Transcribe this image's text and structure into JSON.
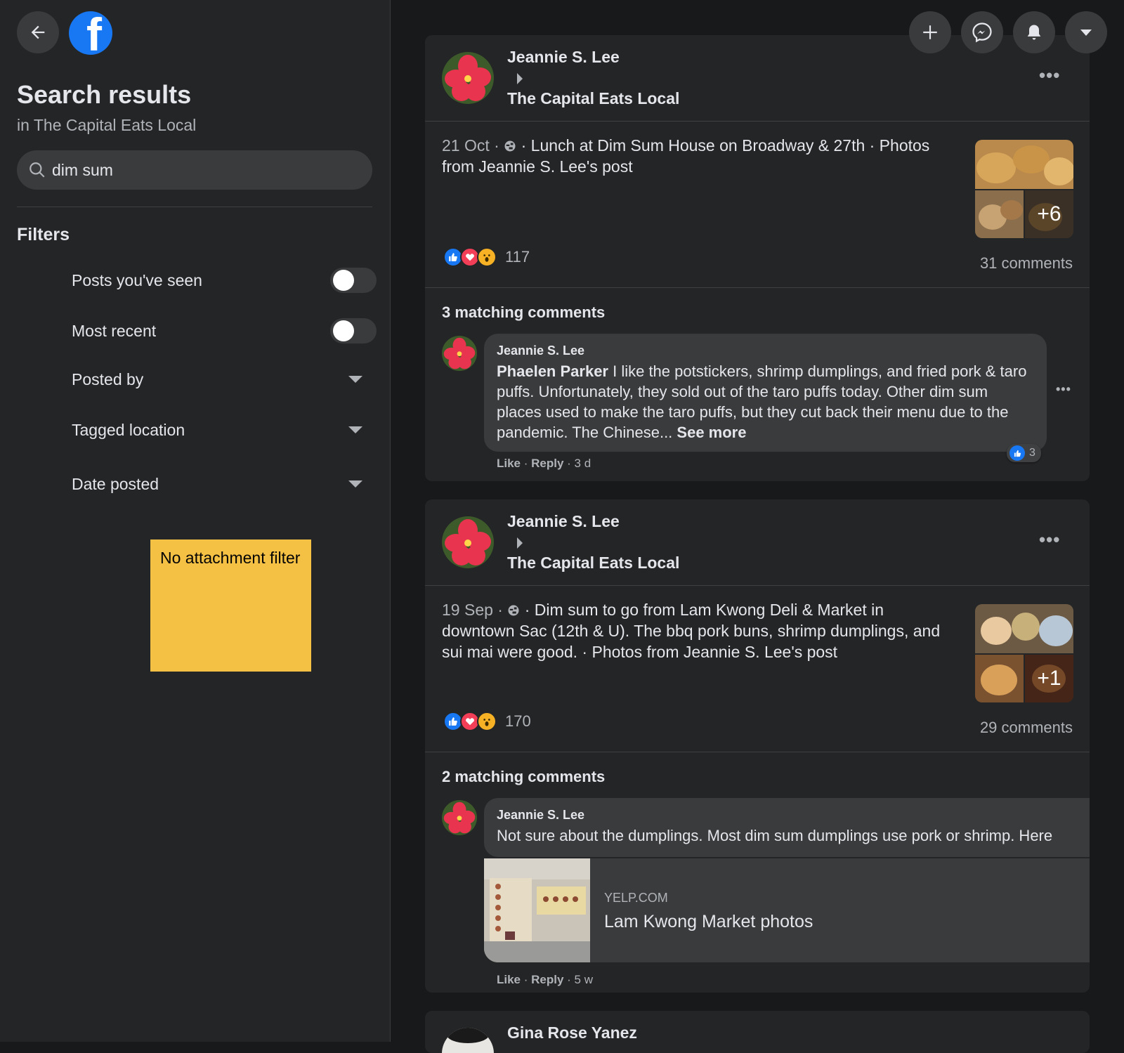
{
  "sidebar": {
    "title": "Search results",
    "subtitle": "in The Capital Eats Local",
    "search_value": "dim sum",
    "filters_heading": "Filters",
    "filters": [
      {
        "label": "Posts you've seen",
        "type": "toggle",
        "on": false
      },
      {
        "label": "Most recent",
        "type": "toggle",
        "on": false
      },
      {
        "label": "Posted by",
        "type": "dropdown"
      },
      {
        "label": "Tagged location",
        "type": "dropdown"
      },
      {
        "label": "Date posted",
        "type": "dropdown"
      }
    ],
    "sticky_note": "No attachment filter"
  },
  "posts": [
    {
      "author": "Jeannie S. Lee",
      "group": "The Capital Eats Local",
      "date": "21 Oct",
      "dot": "·",
      "text": " · Lunch at Dim Sum House on Broadway & 27th · Photos from Jeannie S. Lee's post",
      "photo_more": "+6",
      "reaction_count": "117",
      "comments": "31 comments",
      "matching": "3 matching comments",
      "comment": {
        "author": "Jeannie S. Lee",
        "mention": "Phaelen Parker",
        "text": " I like the potstickers, shrimp dumplings, and fried pork & taro puffs. Unfortunately, they sold out of the taro puffs today. Other dim sum places used to make the taro puffs, but they cut back their menu due to the pandemic. The Chinese... ",
        "see_more": "See more",
        "likes": "3",
        "like": "Like",
        "reply": "Reply",
        "time": "3 d"
      }
    },
    {
      "author": "Jeannie S. Lee",
      "group": "The Capital Eats Local",
      "date": "19 Sep",
      "dot": "·",
      "text": " · Dim sum to go from Lam Kwong Deli & Market in downtown Sac (12th & U). The bbq pork buns, shrimp dumplings, and sui mai were good. · Photos from Jeannie S. Lee's post",
      "photo_more": "+1",
      "reaction_count": "170",
      "comments": "29 comments",
      "matching": "2 matching comments",
      "comment": {
        "author": "Jeannie S. Lee",
        "text": "Not sure about the dumplings. Most dim sum dumplings use pork or shrimp. Here",
        "link_domain": "YELP.COM",
        "link_title": "Lam Kwong Market photos",
        "like": "Like",
        "reply": "Reply",
        "time": "5 w"
      }
    },
    {
      "author": "Gina Rose Yanez"
    }
  ],
  "colors": {
    "background": "#18191a",
    "surface": "#242526",
    "accent": "#1877f2",
    "sticky": "#f4c144"
  },
  "icons": [
    "back-arrow-icon",
    "facebook-logo-icon",
    "plus-icon",
    "messenger-icon",
    "bell-icon",
    "caret-down-icon",
    "search-icon",
    "globe-icon",
    "more-icon",
    "like-icon",
    "love-icon",
    "wow-icon"
  ]
}
